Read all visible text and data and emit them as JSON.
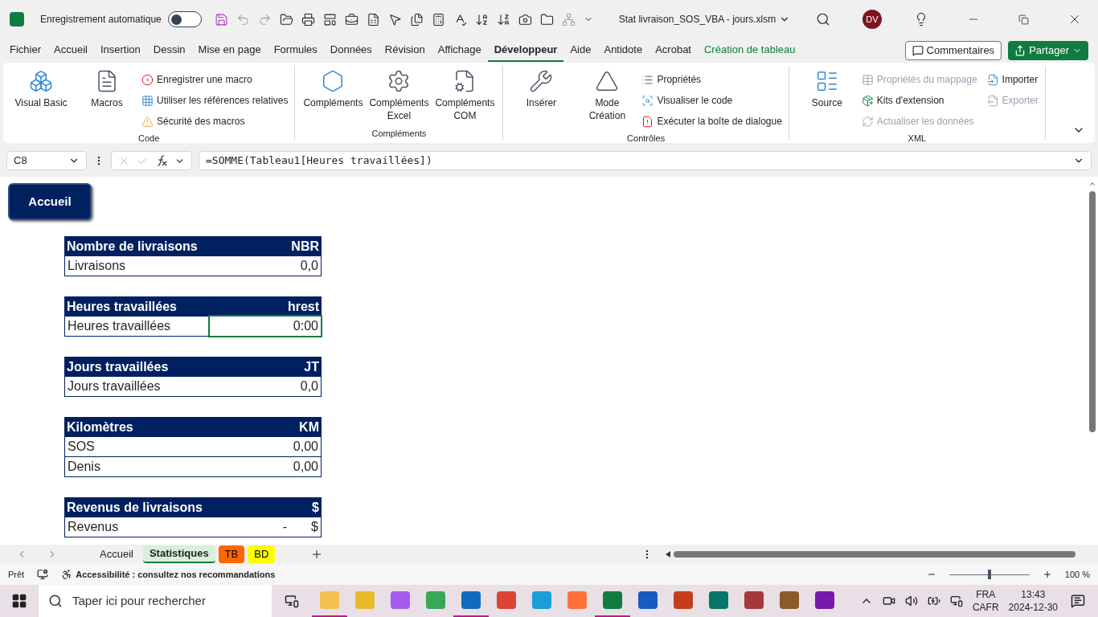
{
  "title_bar": {
    "autosave_label": "Enregistrement automatique",
    "autosave_on": false,
    "file_name": "Stat livraison_SOS_VBA - jours.xlsm",
    "user_initials": "DV"
  },
  "ribbon_tabs": [
    {
      "label": "Fichier",
      "selected": false,
      "kind": "standard"
    },
    {
      "label": "Accueil",
      "selected": false,
      "kind": "standard"
    },
    {
      "label": "Insertion",
      "selected": false,
      "kind": "standard"
    },
    {
      "label": "Dessin",
      "selected": false,
      "kind": "standard"
    },
    {
      "label": "Mise en page",
      "selected": false,
      "kind": "standard"
    },
    {
      "label": "Formules",
      "selected": false,
      "kind": "standard"
    },
    {
      "label": "Données",
      "selected": false,
      "kind": "standard"
    },
    {
      "label": "Révision",
      "selected": false,
      "kind": "standard"
    },
    {
      "label": "Affichage",
      "selected": false,
      "kind": "standard"
    },
    {
      "label": "Développeur",
      "selected": true,
      "kind": "standard"
    },
    {
      "label": "Aide",
      "selected": false,
      "kind": "standard"
    },
    {
      "label": "Antidote",
      "selected": false,
      "kind": "standard"
    },
    {
      "label": "Acrobat",
      "selected": false,
      "kind": "standard"
    },
    {
      "label": "Création de tableau",
      "selected": false,
      "kind": "contextual"
    }
  ],
  "comments_button": "Commentaires",
  "share_button": "Partager",
  "ribbon_groups": [
    {
      "name": "Code",
      "large": [
        {
          "label": "Visual Basic"
        },
        {
          "label": "Macros"
        }
      ],
      "small": [
        {
          "label": "Enregistrer une macro",
          "disabled": false
        },
        {
          "label": "Utiliser les références relatives",
          "disabled": false
        },
        {
          "label": "Sécurité des macros",
          "disabled": false
        }
      ]
    },
    {
      "name": "Compléments",
      "large": [
        {
          "label": "Compléments"
        },
        {
          "label": "Compléments Excel"
        },
        {
          "label": "Compléments COM"
        }
      ]
    },
    {
      "name": "Contrôles",
      "large": [
        {
          "label": "Insérer"
        },
        {
          "label": "Mode Création"
        }
      ],
      "small": [
        {
          "label": "Propriétés",
          "disabled": false
        },
        {
          "label": "Visualiser le code",
          "disabled": false
        },
        {
          "label": "Exécuter la boîte de dialogue",
          "disabled": false
        }
      ]
    },
    {
      "name": "XML",
      "large": [
        {
          "label": "Source"
        }
      ],
      "small": [
        {
          "label": "Propriétés du mappage",
          "disabled": true
        },
        {
          "label": "Kits d'extension",
          "disabled": false
        },
        {
          "label": "Actualiser les données",
          "disabled": true
        },
        {
          "label": "Importer",
          "disabled": false
        },
        {
          "label": "Exporter",
          "disabled": true
        }
      ]
    }
  ],
  "formula_bar": {
    "name_box": "C8",
    "formula": "=SOMME(Tableau1[Heures travaillées])"
  },
  "sheet_button": "Accueil",
  "tables": [
    {
      "header": "Nombre de livraisons",
      "code": "NBR",
      "rows": [
        {
          "label": "Livraisons",
          "value": "0,0",
          "selected": false
        }
      ]
    },
    {
      "header": "Heures travaillées",
      "code": "hrest",
      "rows": [
        {
          "label": "Heures travaillées",
          "value": "0:00",
          "selected": true
        }
      ]
    },
    {
      "header": "Jours travaillées",
      "code": "JT",
      "rows": [
        {
          "label": "Jours travaillées",
          "value": "0,0",
          "selected": false
        }
      ]
    },
    {
      "header": "Kilomètres",
      "code": "KM",
      "rows": [
        {
          "label": "SOS",
          "value": "0,00",
          "selected": false
        },
        {
          "label": "Denis",
          "value": "0,00",
          "selected": false
        }
      ]
    },
    {
      "header": "Revenus de livraisons",
      "code": "$",
      "rows": [
        {
          "label": "Revenus",
          "value": "-",
          "unit": "$",
          "selected": false
        }
      ]
    }
  ],
  "sheet_tabs": [
    {
      "label": "Accueil",
      "selected": false
    },
    {
      "label": "Statistiques",
      "selected": true
    },
    {
      "label": "TB",
      "selected": false,
      "color": "#ff6600"
    },
    {
      "label": "BD",
      "selected": false,
      "color": "#ffff00"
    }
  ],
  "status_bar": {
    "state": "Prêt",
    "accessibility": "Accessibilité : consultez nos recommandations",
    "zoom": "100 %",
    "zoom_slider": {
      "level": 0.5
    }
  },
  "taskbar": {
    "search_placeholder": "Taper ici pour rechercher",
    "language": "FRA",
    "layout": "CAFR",
    "time": "13:43",
    "date": "2024-12-30",
    "apps": [
      {
        "open": true
      },
      {
        "open": false
      },
      {
        "open": false
      },
      {
        "open": false
      },
      {
        "open": true
      },
      {
        "open": false
      },
      {
        "open": false
      },
      {
        "open": false
      },
      {
        "open": true
      },
      {
        "open": false
      },
      {
        "open": false
      },
      {
        "open": false
      },
      {
        "open": false
      },
      {
        "open": false
      },
      {
        "open": false
      }
    ]
  }
}
